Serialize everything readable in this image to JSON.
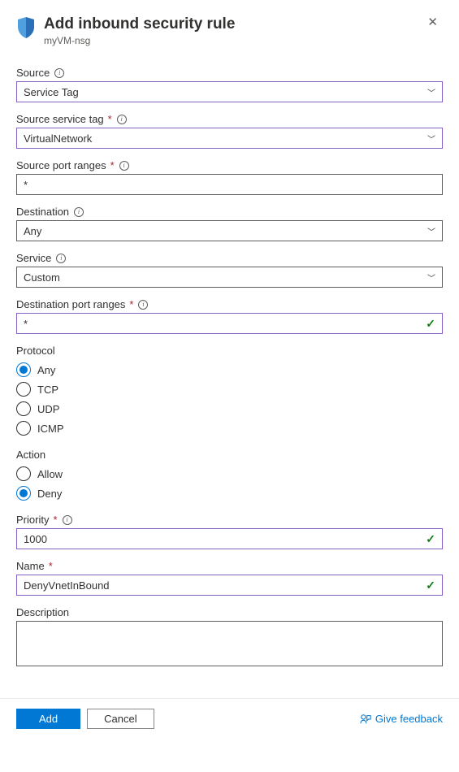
{
  "header": {
    "title": "Add inbound security rule",
    "subtitle": "myVM-nsg"
  },
  "fields": {
    "source": {
      "label": "Source",
      "value": "Service Tag"
    },
    "source_service_tag": {
      "label": "Source service tag",
      "value": "VirtualNetwork"
    },
    "source_port_ranges": {
      "label": "Source port ranges",
      "value": "*"
    },
    "destination": {
      "label": "Destination",
      "value": "Any"
    },
    "service": {
      "label": "Service",
      "value": "Custom"
    },
    "destination_port_ranges": {
      "label": "Destination port ranges",
      "value": "*"
    },
    "protocol": {
      "label": "Protocol",
      "options": [
        "Any",
        "TCP",
        "UDP",
        "ICMP"
      ],
      "selected": "Any"
    },
    "action": {
      "label": "Action",
      "options": [
        "Allow",
        "Deny"
      ],
      "selected": "Deny"
    },
    "priority": {
      "label": "Priority",
      "value": "1000"
    },
    "name": {
      "label": "Name",
      "value": "DenyVnetInBound"
    },
    "description": {
      "label": "Description",
      "value": ""
    }
  },
  "footer": {
    "add": "Add",
    "cancel": "Cancel",
    "feedback": "Give feedback"
  }
}
